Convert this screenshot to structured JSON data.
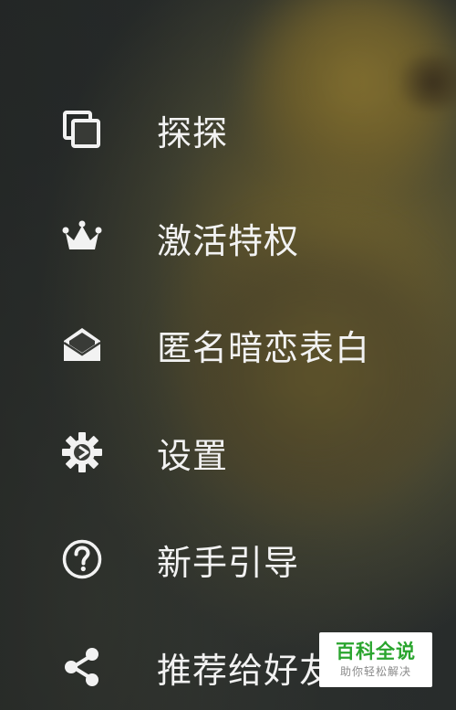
{
  "menu": {
    "items": [
      {
        "label": "探探",
        "icon": "cards-icon"
      },
      {
        "label": "激活特权",
        "icon": "crown-icon"
      },
      {
        "label": "匿名暗恋表白",
        "icon": "open-envelope-icon"
      },
      {
        "label": "设置",
        "icon": "gear-icon"
      },
      {
        "label": "新手引导",
        "icon": "question-circle-icon"
      },
      {
        "label": "推荐给好友",
        "icon": "share-icon"
      }
    ]
  },
  "watermark": {
    "title": "百科全说",
    "subtitle": "助你轻松解决"
  },
  "colors": {
    "text": "#f2f2f2",
    "icon": "#f2f2f2",
    "watermark_green": "#2aa52e"
  }
}
